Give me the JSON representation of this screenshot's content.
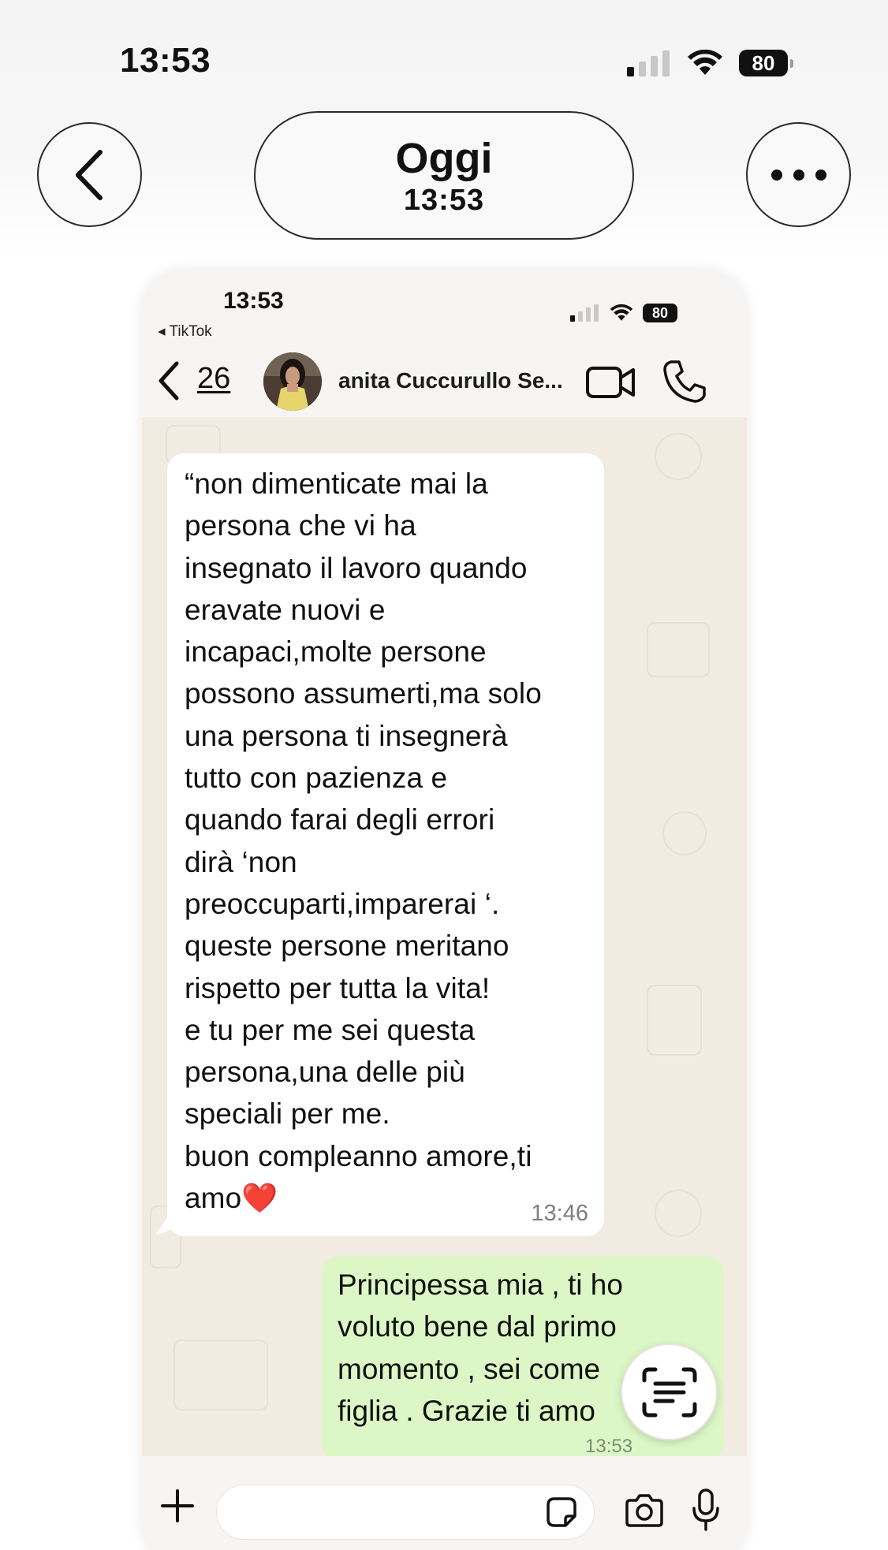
{
  "status_bar": {
    "time": "13:53",
    "battery": "80"
  },
  "header": {
    "title": "Oggi",
    "subtitle": "13:53"
  },
  "screenshot": {
    "status_time": "13:53",
    "back_app": "◂ TikTok",
    "battery": "80",
    "back_count": "26",
    "contact_name": "anita Cuccurullo Se...",
    "messages": [
      {
        "direction": "incoming",
        "text": "“non dimenticate mai la\npersona che vi ha\ninsegnato il lavoro quando\neravate nuovi e\nincapaci,molte persone\npossono assumerti,ma solo\nuna persona ti insegnerà\ntutto con pazienza e\nquando farai degli errori\ndirà ‘non\npreoccuparti,imparerai ‘.\nqueste persone meritano\nrispetto per tutta la vita!\ne tu per me sei questa\npersona,una delle più\nspeciali per me.\nbuon compleanno amore,ti\namo❤️",
        "time": "13:46"
      },
      {
        "direction": "outgoing",
        "text": "Principessa mia , ti ho\nvoluto bene dal primo\nmomento , sei come\nfiglia . Grazie ti amo",
        "time": "13:53"
      }
    ],
    "input_placeholder": ""
  },
  "icons": [
    "back-chevron-icon",
    "more-icon",
    "signal-icon",
    "wifi-icon",
    "battery-icon",
    "video-call-icon",
    "phone-icon",
    "plus-icon",
    "sticker-icon",
    "camera-icon",
    "microphone-icon",
    "text-scan-icon"
  ],
  "colors": {
    "incoming_bubble": "#ffffff",
    "outgoing_bubble": "#dcf7c5",
    "chat_background": "#f1ebe2"
  }
}
